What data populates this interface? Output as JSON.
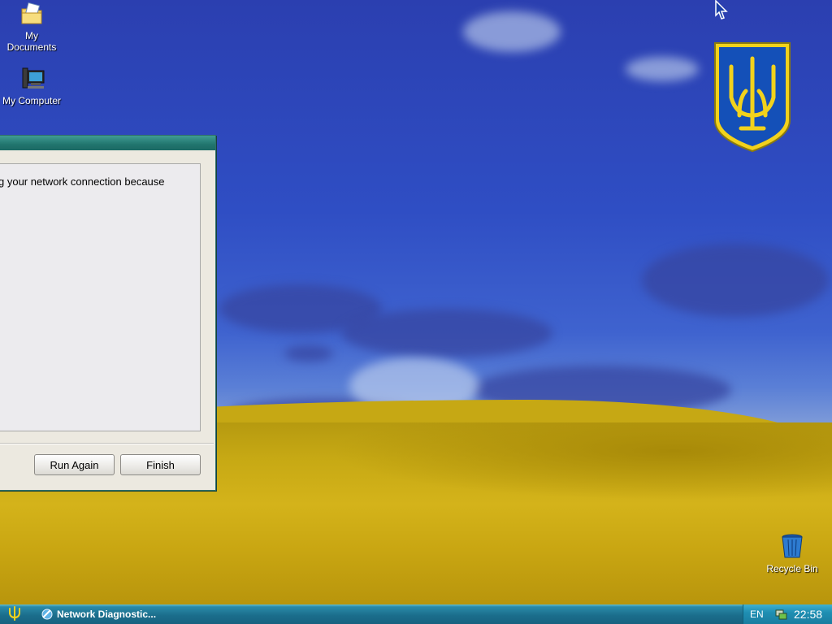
{
  "desktop": {
    "icons": [
      {
        "label_line1": "My",
        "label_line2": "Documents",
        "icon": "my-documents-icon"
      },
      {
        "label": "My Computer",
        "icon": "my-computer-icon"
      },
      {
        "label": "Recycle Bin",
        "icon": "recycle-bin-icon"
      }
    ],
    "wallpaper_emblem": "ukraine-coat-of-arms",
    "colors": {
      "sky": "#2f4ec4",
      "field": "#c7a914"
    }
  },
  "dialog": {
    "message": "g your network connection because",
    "buttons": {
      "run_again": "Run Again",
      "finish": "Finish"
    }
  },
  "taskbar": {
    "start_icon": "trident-icon",
    "task_item": {
      "label": "Network Diagnostic...",
      "icon": "network-diagnostic-icon"
    },
    "tray": {
      "language": "EN",
      "network_icon": "network-status-icon",
      "clock": "22:58"
    },
    "colors": {
      "bar": "#1b6e8c",
      "tray": "#1f8fb3"
    }
  }
}
